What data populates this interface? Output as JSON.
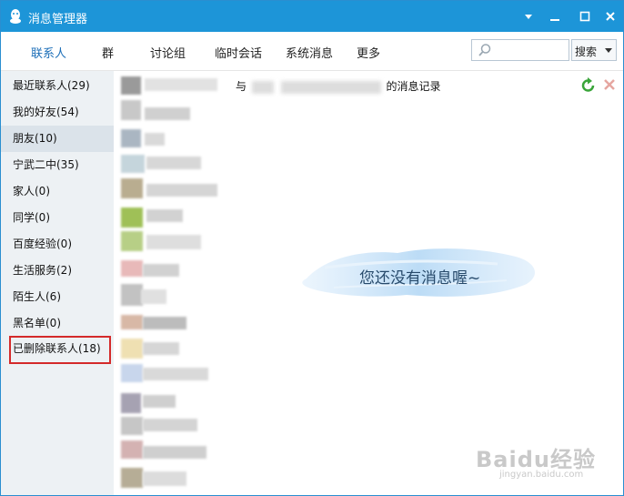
{
  "window": {
    "title": "消息管理器",
    "icons": {
      "logo": "qq-penguin-icon",
      "menu": "dropdown-arrow-icon",
      "minimize": "minimize-icon",
      "maximize": "maximize-icon",
      "close": "close-icon"
    }
  },
  "toolbar": {
    "tabs": [
      "联系人",
      "群",
      "讨论组",
      "临时会话",
      "系统消息",
      "更多"
    ],
    "active_tab": "联系人",
    "search_placeholder": "",
    "search_button": "搜索"
  },
  "sidebar": {
    "items": [
      "最近联系人(29)",
      "我的好友(54)",
      "朋友(10)",
      "宁武二中(35)",
      "家人(0)",
      "同学(0)",
      "百度经验(0)",
      "生活服务(2)",
      "陌生人(6)",
      "黑名单(0)",
      "已删除联系人(18)"
    ],
    "selected": "朋友(10)",
    "highlighted": "已删除联系人(18)"
  },
  "main": {
    "header_prefix": "与",
    "header_suffix": "的消息记录",
    "empty_message": "您还没有消息喔~",
    "icons": {
      "refresh": "refresh-icon",
      "delete": "delete-icon"
    }
  },
  "watermark": {
    "text": "Baidu经验",
    "sub": "jingyan.baidu.com"
  },
  "colors": {
    "titlebar": "#1d95d8",
    "sidebar": "#edf1f4",
    "highlight": "#d42a2a"
  }
}
